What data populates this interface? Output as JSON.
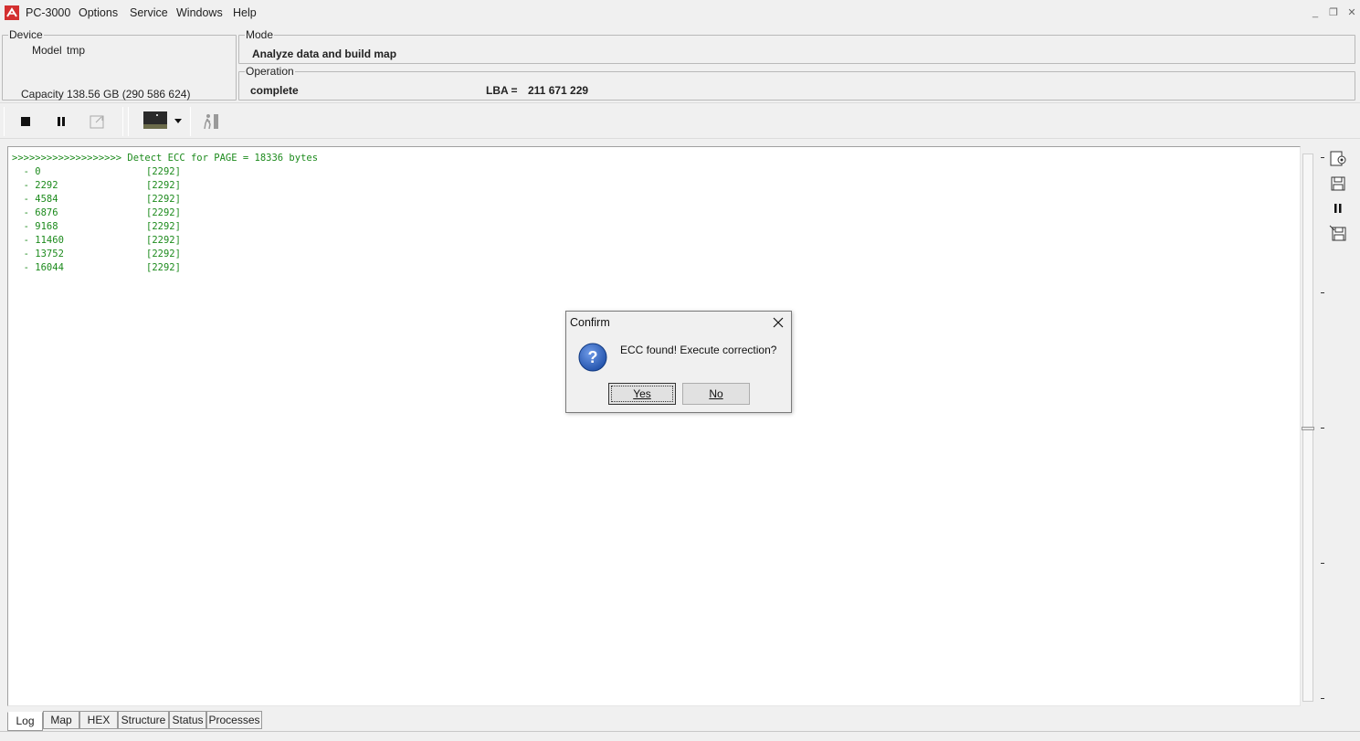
{
  "app": {
    "title": "PC-3000",
    "menu": [
      "Options",
      "Service",
      "Windows",
      "Help"
    ]
  },
  "device": {
    "group_title": "Device",
    "model_label": "Model",
    "model_value": "tmp",
    "capacity_label": "Capacity",
    "capacity_value": "138.56 GB (290 586 624)"
  },
  "mode": {
    "group_title": "Mode",
    "value": "Analyze data and build map"
  },
  "operation": {
    "group_title": "Operation",
    "status": "complete",
    "lba_label": "LBA =",
    "lba_value": "211 671 229"
  },
  "toolbar": {
    "icons": [
      "stop-icon",
      "pause-icon",
      "export-icon",
      "image-preview-icon",
      "dropdown-arrow-icon",
      "run-icon"
    ]
  },
  "log": {
    "header": ">>>>>>>>>>>>>>>>>>> Detect ECC for PAGE = 18336 bytes",
    "rows": [
      {
        "offset": "  - 0",
        "size": "[2292]"
      },
      {
        "offset": "  - 2292",
        "size": "[2292]"
      },
      {
        "offset": "  - 4584",
        "size": "[2292]"
      },
      {
        "offset": "  - 6876",
        "size": "[2292]"
      },
      {
        "offset": "  - 9168",
        "size": "[2292]"
      },
      {
        "offset": "  - 11460",
        "size": "[2292]"
      },
      {
        "offset": "  - 13752",
        "size": "[2292]"
      },
      {
        "offset": "  - 16044",
        "size": "[2292]"
      }
    ],
    "text_color": "#1c8a1c"
  },
  "side_tools": [
    "log-settings-icon",
    "save-icon",
    "pause-icon",
    "save-as-icon"
  ],
  "tabs": [
    "Log",
    "Map",
    "HEX",
    "Structure",
    "Status",
    "Processes"
  ],
  "active_tab": "Log",
  "dialog": {
    "title": "Confirm",
    "message": "ECC  found! Execute correction?",
    "yes_label": "Yes",
    "no_label": "No",
    "icon": "question-icon"
  },
  "colors": {
    "logo": "#d32f2f",
    "question_icon": "#1f4fa8"
  }
}
